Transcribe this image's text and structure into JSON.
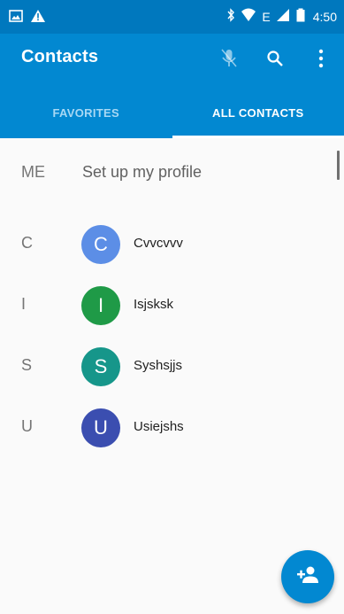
{
  "status_bar": {
    "time": "4:50",
    "icons": [
      "image-icon",
      "warning-icon",
      "bluetooth-icon",
      "wifi-icon",
      "signal-icon",
      "battery-icon"
    ],
    "network_label": "E"
  },
  "app_bar": {
    "title": "Contacts",
    "actions": [
      "mic-icon",
      "search-icon",
      "more-vert-icon"
    ]
  },
  "tabs": [
    {
      "label": "FAVORITES",
      "selected": false
    },
    {
      "label": "ALL CONTACTS",
      "selected": true
    }
  ],
  "me": {
    "letter": "ME",
    "label": "Set up my profile"
  },
  "contacts": [
    {
      "letter": "C",
      "initial": "C",
      "name": "Cvvcvvv",
      "color": "#5c8ee6"
    },
    {
      "letter": "I",
      "initial": "I",
      "name": "Isjsksk",
      "color": "#1f9a47"
    },
    {
      "letter": "S",
      "initial": "S",
      "name": "Syshsjjs",
      "color": "#16968a"
    },
    {
      "letter": "U",
      "initial": "U",
      "name": "Usiejshs",
      "color": "#3b4eb0"
    }
  ],
  "fab": {
    "icon": "add-person-icon"
  },
  "colors": {
    "primary": "#0288d1",
    "status": "#0078be",
    "background": "#fafafa"
  }
}
